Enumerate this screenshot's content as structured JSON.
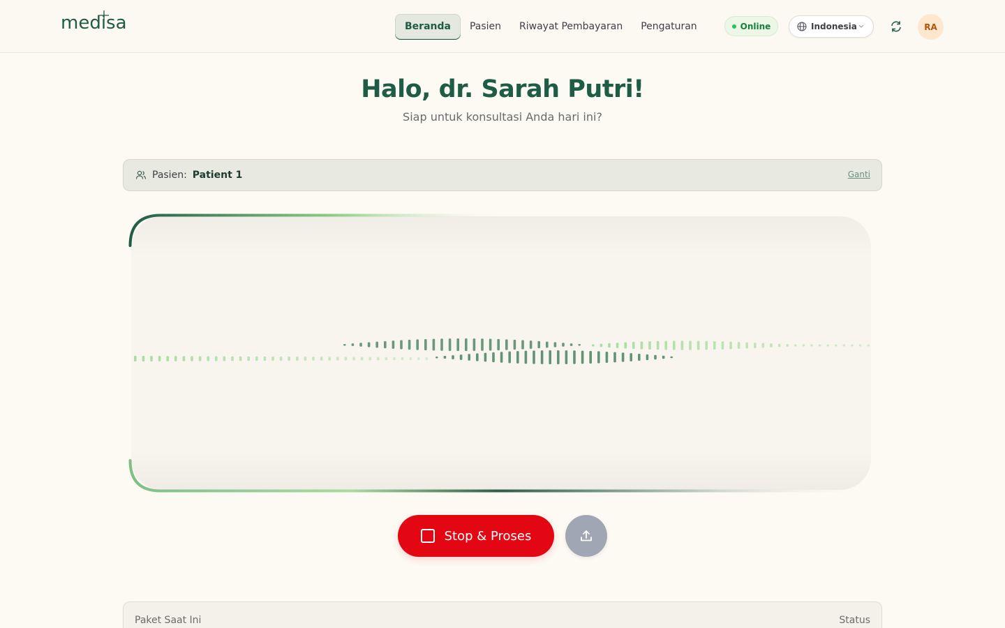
{
  "header": {
    "logo": "medisa",
    "nav": [
      {
        "label": "Beranda",
        "active": true
      },
      {
        "label": "Pasien",
        "active": false
      },
      {
        "label": "Riwayat Pembayaran",
        "active": false
      },
      {
        "label": "Pengaturan",
        "active": false
      }
    ],
    "status": "Online",
    "language": "Indonesia",
    "avatar_initials": "RA",
    "brand_color": "#1f5c45"
  },
  "greeting": {
    "title": "Halo, dr. Sarah Putri!",
    "subtitle": "Siap untuk konsultasi Anda hari ini?"
  },
  "patient": {
    "prefix": "Pasien:",
    "name": "Patient 1",
    "change_label": "Ganti"
  },
  "recorder": {
    "state": "recording",
    "waveform_colors": [
      "#5b8d6e",
      "#a8dca0"
    ]
  },
  "actions": {
    "stop_label": "Stop & Proses",
    "stop_color": "#e30613",
    "upload_icon": "upload-icon"
  },
  "plan_panel": {
    "current_plan_label": "Paket Saat Ini",
    "status_label": "Status"
  }
}
